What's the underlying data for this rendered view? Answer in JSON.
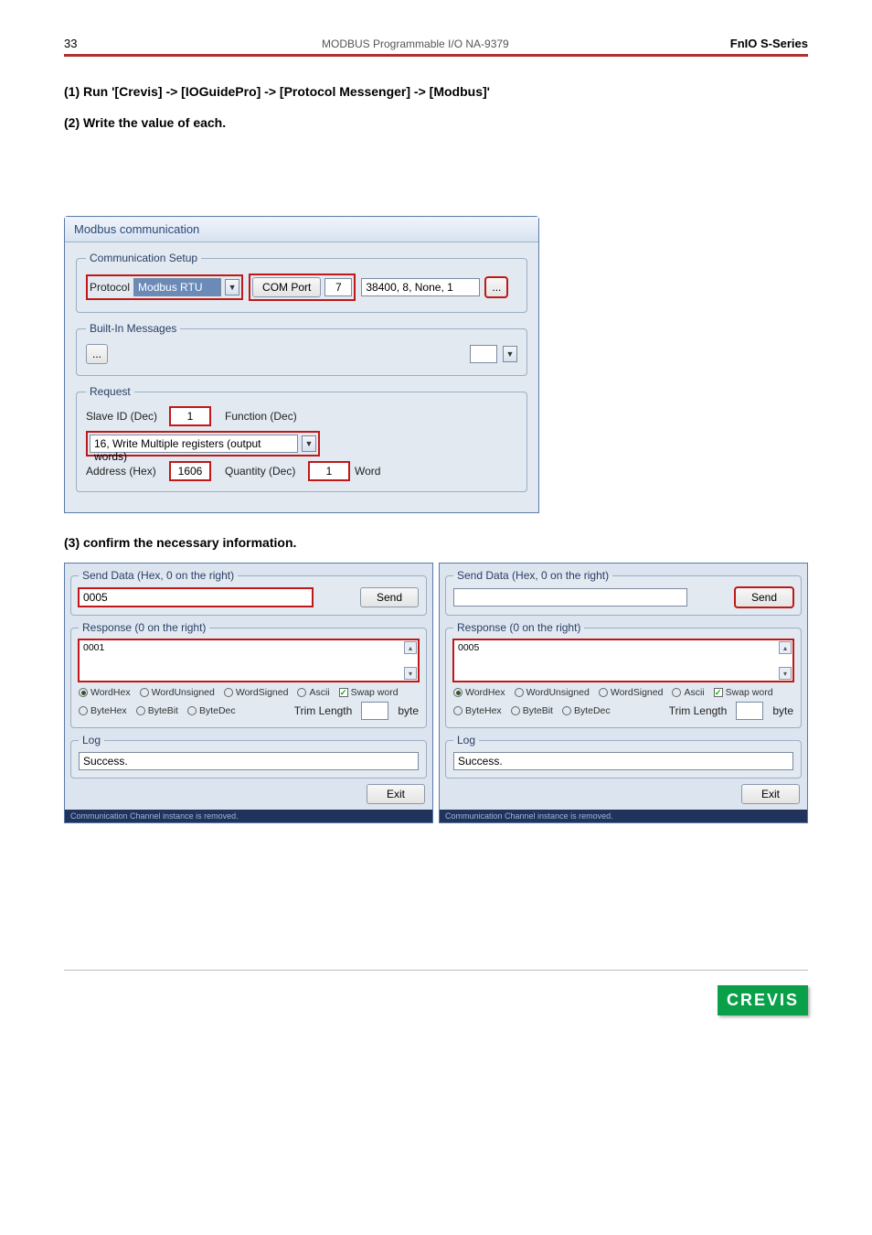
{
  "header": {
    "page_num": "33",
    "doc_title": "MODBUS Programmable I/O NA-9379",
    "series": "FnIO  S-Series"
  },
  "steps": {
    "s1": "(1) Run '[Crevis] -> [IOGuidePro] -> [Protocol Messenger] -> [Modbus]'",
    "s2": "(2) Write the value of each.",
    "s3": "(3) confirm the necessary information."
  },
  "win1": {
    "title": "Modbus communication",
    "comm": {
      "legend": "Communication Setup",
      "protocol_label": "Protocol",
      "protocol_value": "Modbus RTU",
      "comport_label": "COM Port",
      "comport_value": "7",
      "serial_params": "38400, 8, None, 1",
      "more_btn": "..."
    },
    "builtin": {
      "legend": "Built-In Messages",
      "more_btn": "..."
    },
    "request": {
      "legend": "Request",
      "slave_label": "Slave ID (Dec)",
      "slave_value": "1",
      "func_label": "Function (Dec)",
      "func_value": "16, Write Multiple registers (output words)",
      "addr_label": "Address (Hex)",
      "addr_value": "1606",
      "qty_label": "Quantity (Dec)",
      "qty_value": "1",
      "qty_unit": "Word"
    }
  },
  "dlg_left": {
    "send_legend": "Send Data (Hex, 0 on the right)",
    "send_value": "0005",
    "send_btn": "Send",
    "resp_legend": "Response (0 on the right)",
    "resp_value": "0001",
    "radios": {
      "wordhex": "WordHex",
      "wordunsigned": "WordUnsigned",
      "wordsigned": "WordSigned",
      "ascii": "Ascii",
      "swap": "Swap word",
      "bytehex": "ByteHex",
      "bytebit": "ByteBit",
      "bytedec": "ByteDec",
      "trim_label": "Trim Length",
      "trim_unit": "byte"
    },
    "log_legend": "Log",
    "log_value": "Success.",
    "exit_btn": "Exit",
    "status": "Communication Channel instance is removed."
  },
  "dlg_right": {
    "send_legend": "Send Data (Hex, 0 on the right)",
    "send_value": "",
    "send_btn": "Send",
    "resp_legend": "Response (0 on the right)",
    "resp_value": "0005",
    "log_legend": "Log",
    "log_value": "Success.",
    "exit_btn": "Exit",
    "status": "Communication Channel instance is removed."
  },
  "footer": {
    "logo": "CREVIS"
  },
  "chart_data": null
}
